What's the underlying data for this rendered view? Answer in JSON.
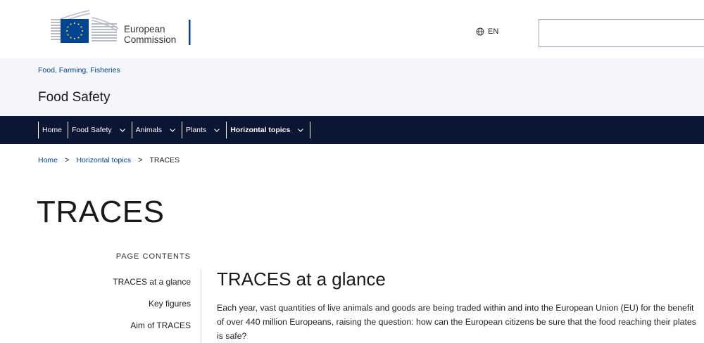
{
  "header": {
    "logo_text_line1": "European",
    "logo_text_line2": "Commission",
    "language_label": "EN",
    "search_value": "",
    "search_placeholder": ""
  },
  "site": {
    "context_link": "Food, Farming, Fisheries",
    "title": "Food Safety"
  },
  "nav": {
    "items": [
      {
        "label": "Home",
        "has_dropdown": false
      },
      {
        "label": "Food Safety",
        "has_dropdown": true
      },
      {
        "label": "Animals",
        "has_dropdown": true
      },
      {
        "label": "Plants",
        "has_dropdown": true
      },
      {
        "label": "Horizontal topics",
        "has_dropdown": true
      }
    ]
  },
  "breadcrumb": {
    "items": [
      "Home",
      "Horizontal topics"
    ],
    "separator": ">",
    "current": "TRACES"
  },
  "page": {
    "title": "TRACES"
  },
  "toc": {
    "heading": "PAGE CONTENTS",
    "items": [
      "TRACES at a glance",
      "Key figures",
      "Aim of TRACES"
    ]
  },
  "content": {
    "section_title": "TRACES at a glance",
    "body": "Each year, vast quantities of live animals and goods are being traded within and into the European Union (EU) for the benefit of over 440 million Europeans, raising the question: how can the European citizens be sure that the food reaching their plates is safe?"
  },
  "colors": {
    "nav_background": "#0b1534",
    "link_blue": "#004494",
    "site_name_background": "#f4f6fb",
    "eu_flag_blue": "#004494",
    "eu_star_yellow": "#ffd617"
  },
  "icons": {
    "language": "globe-icon",
    "dropdown": "chevron-down-icon",
    "breadcrumb_separator": "chevron-right-icon"
  }
}
